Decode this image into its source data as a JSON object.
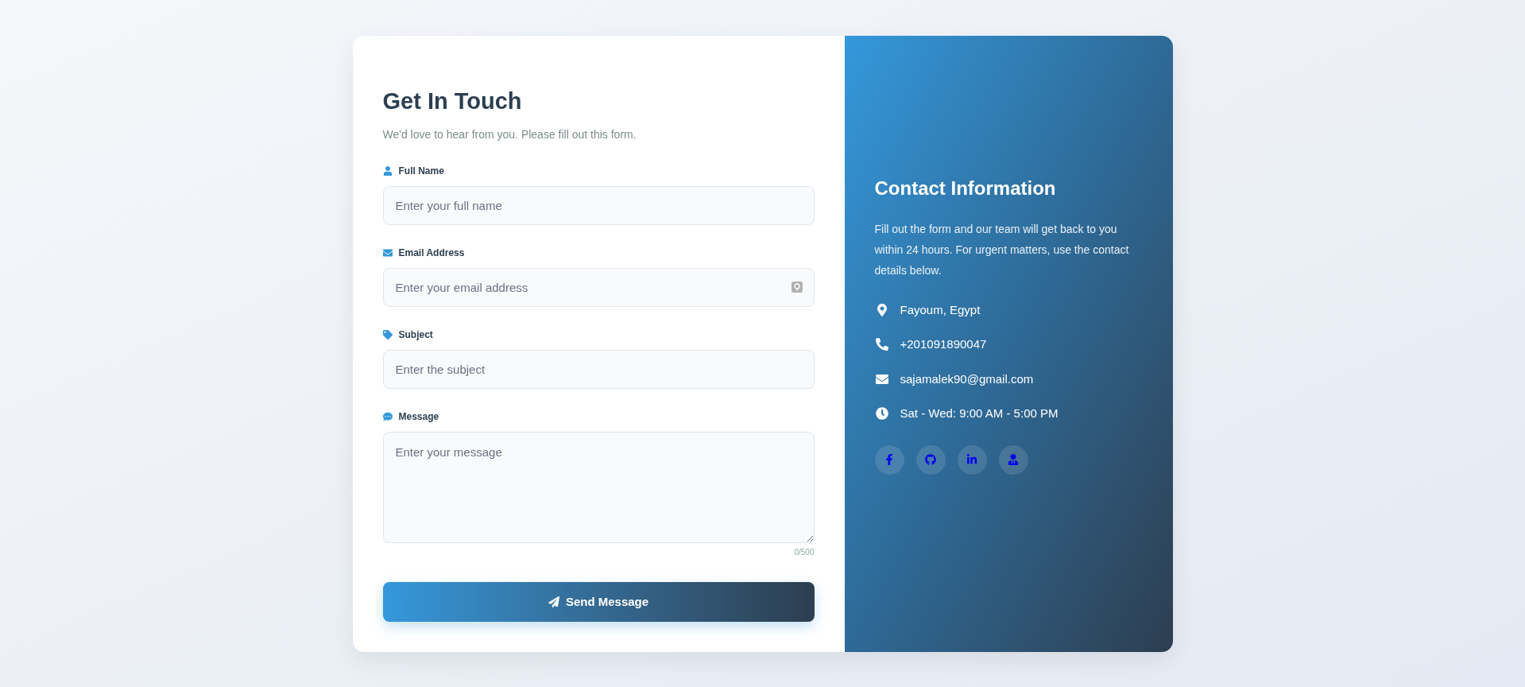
{
  "form": {
    "title": "Get In Touch",
    "subtitle": "We'd love to hear from you. Please fill out this form.",
    "fields": [
      {
        "kind": "name",
        "label": "Full Name",
        "placeholder": "Enter your full name"
      },
      {
        "kind": "email",
        "label": "Email Address",
        "placeholder": "Enter your email address"
      },
      {
        "kind": "subject",
        "label": "Subject",
        "placeholder": "Enter the subject"
      },
      {
        "kind": "message",
        "label": "Message",
        "placeholder": "Enter your message",
        "counter": "0/500"
      }
    ],
    "submit": "Send Message"
  },
  "contact": {
    "title": "Contact Information",
    "description": "Fill out the form and our team will get back to you within 24 hours. For urgent matters, use the contact details below.",
    "items": [
      {
        "kind": "location",
        "text": "Fayoum, Egypt"
      },
      {
        "kind": "phone",
        "text": "+201091890047"
      },
      {
        "kind": "email",
        "text": "sajamalek90@gmail.com"
      },
      {
        "kind": "hours",
        "text": "Sat - Wed: 9:00 AM - 5:00 PM"
      }
    ],
    "socials": [
      {
        "kind": "facebook"
      },
      {
        "kind": "github"
      },
      {
        "kind": "linkedin"
      },
      {
        "kind": "profile"
      }
    ]
  }
}
